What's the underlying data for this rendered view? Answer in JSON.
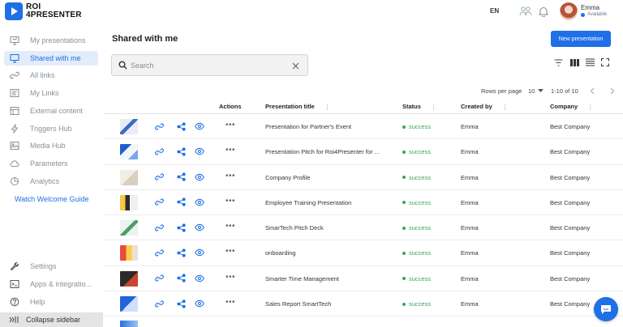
{
  "app": {
    "logo_line1": "ROI",
    "logo_line2": "4PRESENTER"
  },
  "header": {
    "language": "EN",
    "user_name": "Emma",
    "user_status": "Available"
  },
  "sidebar": {
    "items": [
      {
        "label": "My presentations",
        "icon": "presentation-icon"
      },
      {
        "label": "Shared with me",
        "icon": "shared-screen-icon",
        "active": true
      },
      {
        "label": "All links",
        "icon": "link-icon"
      },
      {
        "label": "My Links",
        "icon": "my-links-icon"
      },
      {
        "label": "External content",
        "icon": "external-content-icon"
      },
      {
        "label": "Triggers Hub",
        "icon": "lightning-icon"
      },
      {
        "label": "Media Hub",
        "icon": "image-icon"
      },
      {
        "label": "Parameters",
        "icon": "cloud-icon"
      },
      {
        "label": "Analytics",
        "icon": "analytics-icon"
      }
    ],
    "guide_link": "Watch Welcome Guide",
    "bottom_items": [
      {
        "label": "Settings",
        "icon": "wrench-icon"
      },
      {
        "label": "Apps & integratio...",
        "icon": "terminal-icon"
      },
      {
        "label": "Help",
        "icon": "help-icon"
      }
    ],
    "collapse_label": "Collapse sidebar"
  },
  "main": {
    "title": "Shared with me",
    "new_button": "New presentation",
    "search_placeholder": "Search",
    "rows_per_page_label": "Rows per page",
    "rows_per_page_value": "10",
    "range_label": "1-10 of 10"
  },
  "table": {
    "headers": {
      "actions": "Actions",
      "title": "Presentation title",
      "status": "Status",
      "created_by": "Created by",
      "company": "Company"
    },
    "rows": [
      {
        "title": "Presentation for Partner's Event",
        "status": "success",
        "created_by": "Emma",
        "company": "Best Company"
      },
      {
        "title": "Presentation Pitch for Roi4Presenter for ...",
        "status": "success",
        "created_by": "Emma",
        "company": "Best Company"
      },
      {
        "title": "Company Profile",
        "status": "success",
        "created_by": "Emma",
        "company": "Best Company"
      },
      {
        "title": "Employee Training Presentation",
        "status": "success",
        "created_by": "Emma",
        "company": "Best Company"
      },
      {
        "title": "SmarTech Pitch Deck",
        "status": "success",
        "created_by": "Emma",
        "company": "Best Company"
      },
      {
        "title": "onboarding",
        "status": "success",
        "created_by": "Emma",
        "company": "Best Company"
      },
      {
        "title": "Smarter Time Management",
        "status": "success",
        "created_by": "Emma",
        "company": "Best Company"
      },
      {
        "title": "Sales Report SmartTech",
        "status": "success",
        "created_by": "Emma",
        "company": "Best Company"
      }
    ]
  },
  "colors": {
    "accent": "#1f6fe6",
    "success": "#3aa55a",
    "active_bg": "#e2ecfa"
  }
}
